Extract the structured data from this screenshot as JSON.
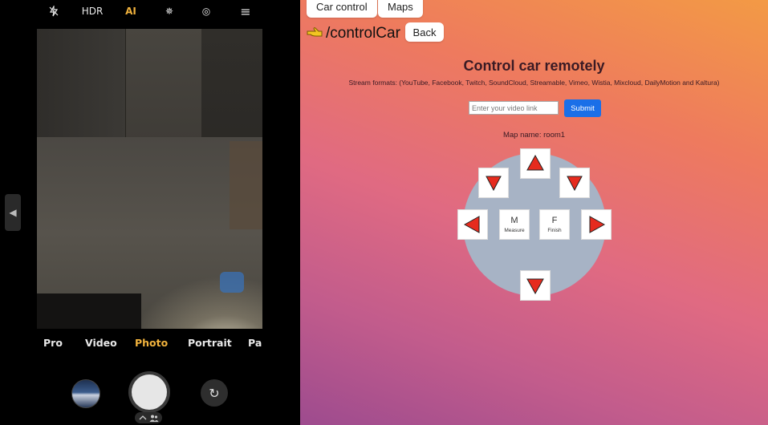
{
  "camera": {
    "top_icons": [
      {
        "name": "flash-off-icon",
        "glyph": "⚡"
      },
      {
        "name": "hdr-label",
        "label": "HDR"
      },
      {
        "name": "ai-label",
        "label": "AI"
      },
      {
        "name": "filter-icon",
        "glyph": "✵"
      },
      {
        "name": "lens-icon",
        "glyph": "◎"
      },
      {
        "name": "menu-icon",
        "glyph": "≡"
      }
    ],
    "modes": [
      "Pro",
      "Video",
      "Photo",
      "Portrait",
      "Pa"
    ],
    "active_mode": "Photo",
    "side_tab_glyph": "◀",
    "flip_glyph": "↻",
    "people_glyph": "⌃ 👥"
  },
  "web": {
    "tabs": [
      {
        "label": "Car control"
      },
      {
        "label": "Maps"
      }
    ],
    "route": "/controlCar",
    "hand_glyph": "👉",
    "back_label": "Back",
    "title": "Control car remotely",
    "stream_formats": "Stream formats: (YouTube, Facebook, Twitch, SoundCloud, Streamable, Vimeo, Wistia, Mixcloud, DailyMotion and Kaltura)",
    "video_input": {
      "placeholder": "Enter your video link",
      "value": ""
    },
    "submit_label": "Submit",
    "map_name_label": "Map name: room1",
    "controls": {
      "measure": {
        "letter": "M",
        "caption": "Measure"
      },
      "finish": {
        "letter": "F",
        "caption": "Finish"
      }
    },
    "colors": {
      "arrow": "#e62b1e",
      "submit": "#1a6fe8",
      "pad": "#a7b3c5"
    }
  }
}
